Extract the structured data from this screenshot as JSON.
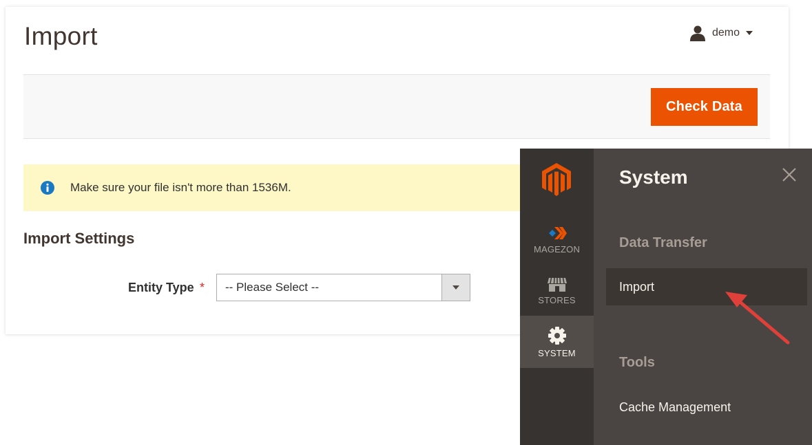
{
  "page": {
    "title": "Import"
  },
  "user_menu": {
    "username": "demo",
    "icon": "user-icon",
    "caret_icon": "caret-down-icon"
  },
  "action_bar": {
    "check_data_label": "Check Data"
  },
  "notice": {
    "icon": "info-icon",
    "text": "Make sure your file isn't more than 1536M."
  },
  "import_settings": {
    "section_title": "Import Settings",
    "entity_type": {
      "label": "Entity Type",
      "required_marker": "*",
      "value": "-- Please Select --"
    }
  },
  "sidebar": {
    "logo": "magento-logo",
    "items": [
      {
        "label": "MAGEZON",
        "icon": "magezon-icon",
        "active": false
      },
      {
        "label": "STORES",
        "icon": "store-icon",
        "active": false
      },
      {
        "label": "SYSTEM",
        "icon": "gear-icon",
        "active": true
      }
    ]
  },
  "flyout": {
    "title": "System",
    "close_icon": "close-icon",
    "groups": [
      {
        "title": "Data Transfer",
        "items": [
          {
            "label": "Import",
            "highlighted": true
          }
        ]
      },
      {
        "title": "Tools",
        "items": [
          {
            "label": "Cache Management",
            "highlighted": false
          }
        ]
      }
    ]
  },
  "colors": {
    "accent": "#eb5202",
    "notice_background": "#fdf8c6",
    "info_icon": "#1979c3",
    "required": "#e22626",
    "sidebar_background": "#373330",
    "flyout_background": "#4a4542",
    "annotation_arrow": "#e0403a"
  }
}
